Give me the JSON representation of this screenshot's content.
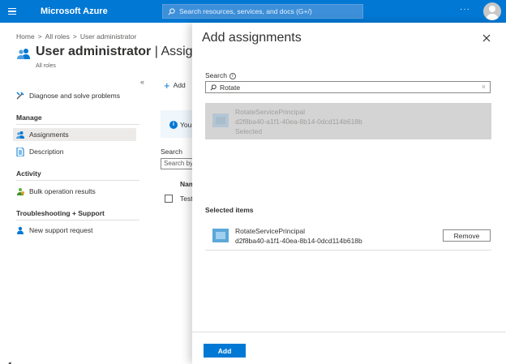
{
  "topbar": {
    "brand": "Microsoft Azure",
    "search_placeholder": "Search resources, services, and docs (G+/)",
    "more": "···"
  },
  "breadcrumb": [
    "Home",
    "All roles",
    "User administrator"
  ],
  "page": {
    "title": "User administrator",
    "title_suffix": "| Assign",
    "subtitle": "All roles",
    "collapse": "«"
  },
  "nav": {
    "diagnose": "Diagnose and solve problems",
    "manage_heading": "Manage",
    "assignments": "Assignments",
    "description": "Description",
    "activity_heading": "Activity",
    "bulk": "Bulk operation results",
    "troubleshooting_heading": "Troubleshooting + Support",
    "support": "New support request"
  },
  "content": {
    "add": "Add",
    "banner_text": "You",
    "search_label": "Search",
    "search_placeholder": "Search by",
    "column_name": "Nam",
    "row_text": "Test"
  },
  "panel": {
    "title": "Add assignments",
    "search_label": "Search",
    "search_value": "Rotate",
    "result": {
      "name": "RotateServicePrincipal",
      "id": "d2f8ba40-a1f1-40ea-8b14-0dcd114b618b",
      "status": "Selected"
    },
    "selected_heading": "Selected items",
    "selected_item": {
      "name": "RotateServicePrincipal",
      "id": "d2f8ba40-a1f1-40ea-8b14-0dcd114b618b"
    },
    "remove_label": "Remove",
    "add_label": "Add"
  },
  "colors": {
    "azure_blue": "#0078d4",
    "selected_row": "#d4d4d4",
    "nav_active": "#edebe9"
  }
}
